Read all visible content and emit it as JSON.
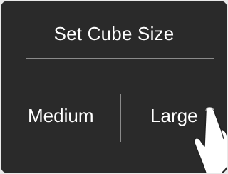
{
  "dialog": {
    "title": "Set Cube Size",
    "options": [
      {
        "label": "Medium"
      },
      {
        "label": "Large"
      }
    ]
  },
  "icons": {
    "pointer": "hand-pointer-icon"
  },
  "colors": {
    "background": "#2a2a2a",
    "text": "#ffffff",
    "divider": "#8a8a8a"
  }
}
